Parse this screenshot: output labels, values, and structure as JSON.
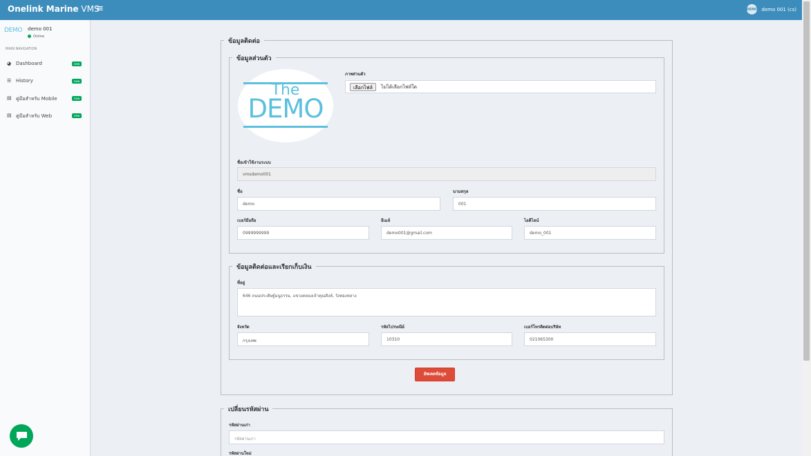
{
  "header": {
    "brand_bold": "Onelink Marine",
    "brand_light": "VMS",
    "menu_icon": "hamburger-icon",
    "avatar_text": "DEMO",
    "user_name": "demo 001 (cs)"
  },
  "sidebar": {
    "logo_text": "DEMO",
    "user_name": "demo 001",
    "status": "Online",
    "nav_header": "MAIN NAVIGATION",
    "items": [
      {
        "label": "Dashboard",
        "badge": "new",
        "icon": "dashboard-icon"
      },
      {
        "label": "History",
        "badge": "new",
        "icon": "history-icon"
      },
      {
        "label": "คู่มือสำหรับ Mobile",
        "badge": "new",
        "icon": "book-icon"
      },
      {
        "label": "คู่มือสำหรับ Web",
        "badge": "new",
        "icon": "book-icon"
      }
    ]
  },
  "contact_section": {
    "legend": "ข้อมูลติดต่อ",
    "personal": {
      "legend": "ข้อมูลส่วนตัว",
      "logo_top": "The",
      "logo_bottom": "DEMO",
      "photo_label": "ภาพส่วนตัว",
      "file_button": "เลือกไฟล์",
      "file_status": "ไม่ได้เลือกไฟล์ใด",
      "username_label": "ชื่อเข้าใช้งานระบบ",
      "username_value": "vmsdemo001",
      "first_name_label": "ชื่อ",
      "first_name_value": "demo",
      "last_name_label": "นามสกุล",
      "last_name_value": "001",
      "mobile_label": "เบอร์มือถือ",
      "mobile_value": "0999999999",
      "email_label": "อีเมล์",
      "email_value": "demo001@gmail.com",
      "line_label": "ไอดีไลน์",
      "line_value": "demo_001"
    },
    "billing": {
      "legend": "ข้อมูลติดต่อและเรียกเก็บเงิน",
      "address_label": "ที่อยู่",
      "address_value": "646 ถนนประดิษฐ์มนูธรรม, แขวงคลองเจ้าคุณสิงห์, วังทองหลาง",
      "province_label": "จังหวัด",
      "province_value": "กรุงเทพ",
      "postcode_label": "รหัสไปรษณีย์",
      "postcode_value": "10310",
      "company_phone_label": "เบอร์โทรติดต่อบริษัท",
      "company_phone_value": "021065300"
    },
    "update_button": "อัพเดตข้อมูล"
  },
  "password_section": {
    "legend": "เปลี่ยนรหัสผ่าน",
    "old_password_label": "รหัสผ่านเก่า",
    "old_password_placeholder": "รหัสผ่านเกา",
    "new_password_label": "รหัสผ่านใหม่"
  },
  "colors": {
    "header": "#3c8dbc",
    "badge": "#00a65a",
    "update_button": "#dd4b39",
    "logo": "#5bc0de"
  }
}
